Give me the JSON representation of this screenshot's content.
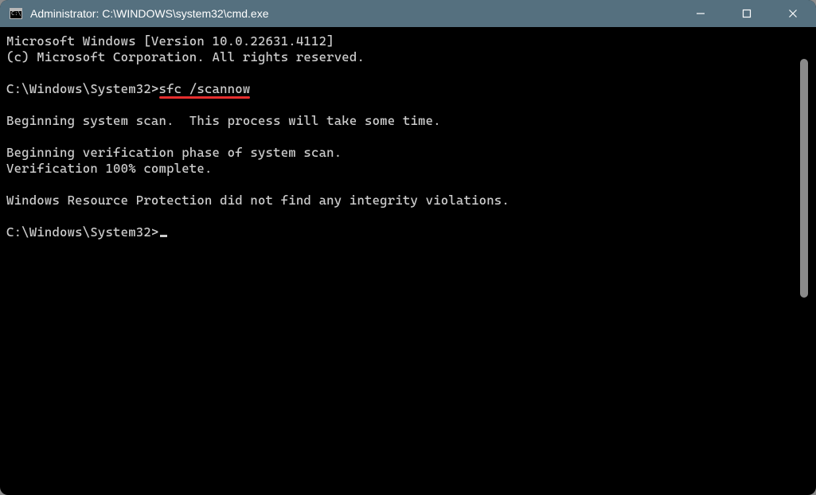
{
  "window": {
    "title": "Administrator: C:\\WINDOWS\\system32\\cmd.exe"
  },
  "terminal": {
    "version_line": "Microsoft Windows [Version 10.0.22631.4112]",
    "copyright_line": "(c) Microsoft Corporation. All rights reserved.",
    "prompt1_path": "C:\\Windows\\System32>",
    "prompt1_cmd": "sfc /scannow",
    "begin_scan": "Beginning system scan.  This process will take some time.",
    "begin_verif": "Beginning verification phase of system scan.",
    "verif_done": "Verification 100% complete.",
    "result_line": "Windows Resource Protection did not find any integrity violations.",
    "prompt2": "C:\\Windows\\System32>"
  }
}
